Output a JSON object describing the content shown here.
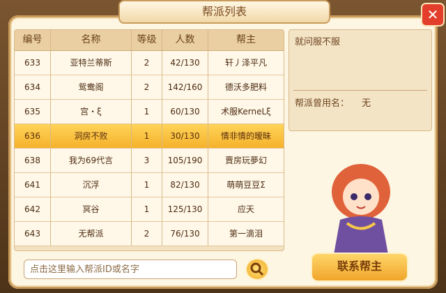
{
  "window": {
    "title": "帮派列表"
  },
  "table": {
    "headers": [
      "编号",
      "名称",
      "等级",
      "人数",
      "帮主"
    ],
    "rows": [
      {
        "id": "633",
        "name": "亚特兰蒂斯",
        "level": "2",
        "members": "42/130",
        "leader": "轩丿泽平凡"
      },
      {
        "id": "634",
        "name": "鸳鸯阁",
        "level": "2",
        "members": "142/160",
        "leader": "德沃多肥料"
      },
      {
        "id": "635",
        "name": "宫・ξ",
        "level": "1",
        "members": "60/130",
        "leader": "术服KerneLξ"
      },
      {
        "id": "636",
        "name": "洞房不败",
        "level": "1",
        "members": "30/130",
        "leader": "情非情的暧昧"
      },
      {
        "id": "638",
        "name": "我为69代言",
        "level": "3",
        "members": "105/190",
        "leader": "賣房玩夢幻"
      },
      {
        "id": "641",
        "name": "沉浮",
        "level": "1",
        "members": "82/130",
        "leader": "萌萌豆豆Σ"
      },
      {
        "id": "642",
        "name": "冥谷",
        "level": "1",
        "members": "125/130",
        "leader": "应天"
      },
      {
        "id": "643",
        "name": "无帮派",
        "level": "2",
        "members": "76/130",
        "leader": "第一滴泪"
      }
    ],
    "selected_index": 3
  },
  "detail": {
    "declaration": "就问服不服",
    "former_name_label": "帮派曾用名：",
    "former_name_value": "无"
  },
  "search": {
    "placeholder": "点击这里输入帮派ID或名字"
  },
  "buttons": {
    "contact_leader": "联系帮主",
    "close": "✕"
  },
  "icons": {
    "close": "close-icon",
    "search": "search-icon",
    "npc": "npc-girl-portrait"
  },
  "colors": {
    "accent": "#f5b12a",
    "close_red": "#e33d2b"
  }
}
